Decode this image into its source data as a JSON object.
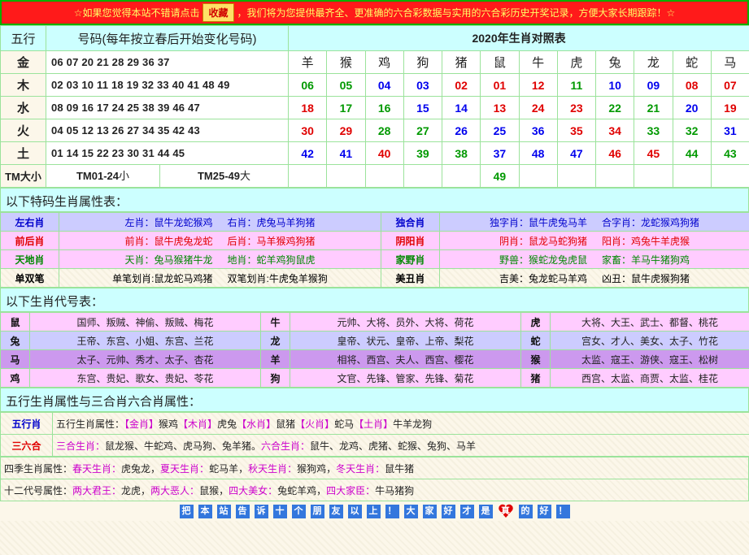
{
  "topbar": {
    "prefix": "☆如果您觉得本站不错请点击",
    "button": "收藏",
    "suffix": "，我们将为您提供最齐全、更准确的六合彩数据与实用的六合彩历史开奖记录，方便大家长期跟踪！☆"
  },
  "header": {
    "elem_label": "五行",
    "nums_label": "号码(每年按立春后开始变化号码)",
    "table_title": "2020年生肖对照表"
  },
  "zodiac": [
    "羊",
    "猴",
    "鸡",
    "狗",
    "猪",
    "鼠",
    "牛",
    "虎",
    "兔",
    "龙",
    "蛇",
    "马"
  ],
  "elements": [
    {
      "name": "金",
      "nums": "06 07 20 21 28 29 36 37"
    },
    {
      "name": "木",
      "nums": "02 03 10 11 18 19 32 33 40 41 48 49"
    },
    {
      "name": "水",
      "nums": "08 09 16 17 24 25 38 39 46 47"
    },
    {
      "name": "火",
      "nums": "04 05 12 13 26 27 34 35 42 43"
    },
    {
      "name": "土",
      "nums": "01 14 15 22 23 30 31 44 45"
    }
  ],
  "grid": [
    [
      {
        "v": "06",
        "c": "green"
      },
      {
        "v": "05",
        "c": "green"
      },
      {
        "v": "04",
        "c": "blue"
      },
      {
        "v": "03",
        "c": "blue"
      },
      {
        "v": "02",
        "c": "red"
      },
      {
        "v": "01",
        "c": "red"
      },
      {
        "v": "12",
        "c": "red"
      },
      {
        "v": "11",
        "c": "green"
      },
      {
        "v": "10",
        "c": "blue"
      },
      {
        "v": "09",
        "c": "blue"
      },
      {
        "v": "08",
        "c": "red"
      },
      {
        "v": "07",
        "c": "red"
      }
    ],
    [
      {
        "v": "18",
        "c": "red"
      },
      {
        "v": "17",
        "c": "green"
      },
      {
        "v": "16",
        "c": "green"
      },
      {
        "v": "15",
        "c": "blue"
      },
      {
        "v": "14",
        "c": "blue"
      },
      {
        "v": "13",
        "c": "red"
      },
      {
        "v": "24",
        "c": "red"
      },
      {
        "v": "23",
        "c": "red"
      },
      {
        "v": "22",
        "c": "green"
      },
      {
        "v": "21",
        "c": "green"
      },
      {
        "v": "20",
        "c": "blue"
      },
      {
        "v": "19",
        "c": "red"
      }
    ],
    [
      {
        "v": "30",
        "c": "red"
      },
      {
        "v": "29",
        "c": "red"
      },
      {
        "v": "28",
        "c": "green"
      },
      {
        "v": "27",
        "c": "green"
      },
      {
        "v": "26",
        "c": "blue"
      },
      {
        "v": "25",
        "c": "blue"
      },
      {
        "v": "36",
        "c": "blue"
      },
      {
        "v": "35",
        "c": "red"
      },
      {
        "v": "34",
        "c": "red"
      },
      {
        "v": "33",
        "c": "green"
      },
      {
        "v": "32",
        "c": "green"
      },
      {
        "v": "31",
        "c": "blue"
      }
    ],
    [
      {
        "v": "42",
        "c": "blue"
      },
      {
        "v": "41",
        "c": "blue"
      },
      {
        "v": "40",
        "c": "red"
      },
      {
        "v": "39",
        "c": "green"
      },
      {
        "v": "38",
        "c": "green"
      },
      {
        "v": "37",
        "c": "blue"
      },
      {
        "v": "48",
        "c": "blue"
      },
      {
        "v": "47",
        "c": "blue"
      },
      {
        "v": "46",
        "c": "red"
      },
      {
        "v": "45",
        "c": "red"
      },
      {
        "v": "44",
        "c": "green"
      },
      {
        "v": "43",
        "c": "green"
      }
    ],
    [
      {
        "v": "",
        "c": ""
      },
      {
        "v": "",
        "c": ""
      },
      {
        "v": "",
        "c": ""
      },
      {
        "v": "",
        "c": ""
      },
      {
        "v": "",
        "c": ""
      },
      {
        "v": "49",
        "c": "green"
      },
      {
        "v": "",
        "c": ""
      },
      {
        "v": "",
        "c": ""
      },
      {
        "v": "",
        "c": ""
      },
      {
        "v": "",
        "c": ""
      },
      {
        "v": "",
        "c": ""
      },
      {
        "v": "",
        "c": ""
      }
    ]
  ],
  "tm": {
    "label": "TM大小",
    "small_prefix": "TM01-24",
    "small_suffix": "小",
    "big_prefix": "TM25-49",
    "big_suffix": "大"
  },
  "sections": {
    "special": "以下特码生肖属性表：",
    "codes": "以下生肖代号表：",
    "wuxing": "五行生肖属性与三合肖六合肖属性："
  },
  "attributes": [
    {
      "tag": "左右肖",
      "tagColor": "b",
      "bg": "lav",
      "l1": "左肖：鼠牛龙蛇猴鸡",
      "l2": "右肖：虎兔马羊狗猪",
      "lc": "b",
      "tag2": "独合肖",
      "tag2Color": "b",
      "bg2": "lav",
      "r1": "独字肖：鼠牛虎兔马羊",
      "r2": "合字肖：龙蛇猴鸡狗猪",
      "rc": "b"
    },
    {
      "tag": "前后肖",
      "tagColor": "r",
      "bg": "pink",
      "l1": "前肖：鼠牛虎兔龙蛇",
      "l2": "后肖：马羊猴鸡狗猪",
      "lc": "r",
      "tag2": "阴阳肖",
      "tag2Color": "r",
      "bg2": "pink",
      "r1": "阴肖：鼠龙马蛇狗猪",
      "r2": "阳肖：鸡兔牛羊虎猴",
      "rc": "r"
    },
    {
      "tag": "天地肖",
      "tagColor": "g",
      "bg": "pink",
      "l1": "天肖：兔马猴猪牛龙",
      "l2": "地肖：蛇羊鸡狗鼠虎",
      "lc": "g",
      "tag2": "家野肖",
      "tag2Color": "g",
      "bg2": "pink",
      "r1": "野兽：猴蛇龙兔虎鼠",
      "r2": "家畜：羊马牛猪狗鸡",
      "rc": "g"
    },
    {
      "tag": "单双笔",
      "tagColor": "k",
      "bg": "none",
      "l1": "单笔划肖:鼠龙蛇马鸡猪",
      "l2": "双笔划肖:牛虎兔羊猴狗",
      "lc": "k",
      "tag2": "美丑肖",
      "tag2Color": "k",
      "bg2": "none",
      "r1": "吉美：兔龙蛇马羊鸡",
      "r2": "凶丑：鼠牛虎猴狗猪",
      "rc": "k"
    }
  ],
  "codes": [
    {
      "bg": "c-pk",
      "a": {
        "z": "鼠",
        "t": "国师、叛贼、神偷、叛贼、梅花"
      },
      "b": {
        "z": "牛",
        "t": "元帅、大将、员外、大将、荷花"
      },
      "c": {
        "z": "虎",
        "t": "大将、大王、武士、都督、桃花"
      }
    },
    {
      "bg": "c-lv",
      "a": {
        "z": "兔",
        "t": "王帝、东宫、小姐、东宫、兰花"
      },
      "b": {
        "z": "龙",
        "t": "皇帝、状元、皇帝、上帝、梨花"
      },
      "c": {
        "z": "蛇",
        "t": "宫女、才人、美女、太子、竹花"
      }
    },
    {
      "bg": "c-pu",
      "a": {
        "z": "马",
        "t": "太子、元帅、秀才、太子、杏花"
      },
      "b": {
        "z": "羊",
        "t": "相将、西宫、夫人、西宫、樱花"
      },
      "c": {
        "z": "猴",
        "t": "太监、寇王、游侠、寇王、松树"
      }
    },
    {
      "bg": "c-pk",
      "a": {
        "z": "鸡",
        "t": "东宫、贵妃、歌女、贵妃、苓花"
      },
      "b": {
        "z": "狗",
        "t": "文官、先锋、管家、先锋、菊花"
      },
      "c": {
        "z": "猪",
        "t": "西宫、太监、商贾、太监、桂花"
      }
    }
  ],
  "wuxing": {
    "tag": "五行肖",
    "lead": "五行生肖属性：",
    "parts": [
      {
        "k": "【金肖】",
        "v": "猴鸡"
      },
      {
        "k": "【木肖】",
        "v": "虎兔"
      },
      {
        "k": "【水肖】",
        "v": "鼠猪"
      },
      {
        "k": "【火肖】",
        "v": "蛇马"
      },
      {
        "k": "【土肖】",
        "v": "牛羊龙狗"
      }
    ]
  },
  "sanhe": {
    "tag": "三六合",
    "lead1": "三合生肖：",
    "v1": "鼠龙猴、牛蛇鸡、虎马狗、兔羊猪。",
    "lead2": "六合生肖：",
    "v2": "鼠牛、龙鸡、虎猪、蛇猴、兔狗、马羊"
  },
  "seasons": {
    "lead": "四季生肖属性：",
    "parts": [
      {
        "k": "春天生肖：",
        "v": "虎兔龙，",
        "c": "pur"
      },
      {
        "k": "夏天生肖：",
        "v": "蛇马羊，",
        "c": "pur"
      },
      {
        "k": "秋天生肖：",
        "v": "猴狗鸡，",
        "c": "pur"
      },
      {
        "k": "冬天生肖：",
        "v": "鼠牛猪",
        "c": "pur"
      }
    ]
  },
  "twelve": {
    "lead": "十二代号属性：",
    "parts": [
      {
        "k": "两大君王：",
        "v": "龙虎，"
      },
      {
        "k": "两大恶人：",
        "v": "鼠猴，"
      },
      {
        "k": "四大美女：",
        "v": "兔蛇羊鸡，"
      },
      {
        "k": "四大家臣：",
        "v": "牛马猪狗"
      }
    ]
  },
  "footer": [
    "把",
    "本",
    "站",
    "告",
    "诉",
    "十",
    "个",
    "朋",
    "友",
    "以",
    "上",
    "！",
    "大",
    "家",
    "好",
    "才",
    "是",
    "真",
    "的",
    "好",
    "！"
  ],
  "colors": {
    "red": "#e00000",
    "blue": "#0000ee",
    "green": "#009900",
    "cyan": "#ccffff",
    "border": "#9be39b"
  }
}
